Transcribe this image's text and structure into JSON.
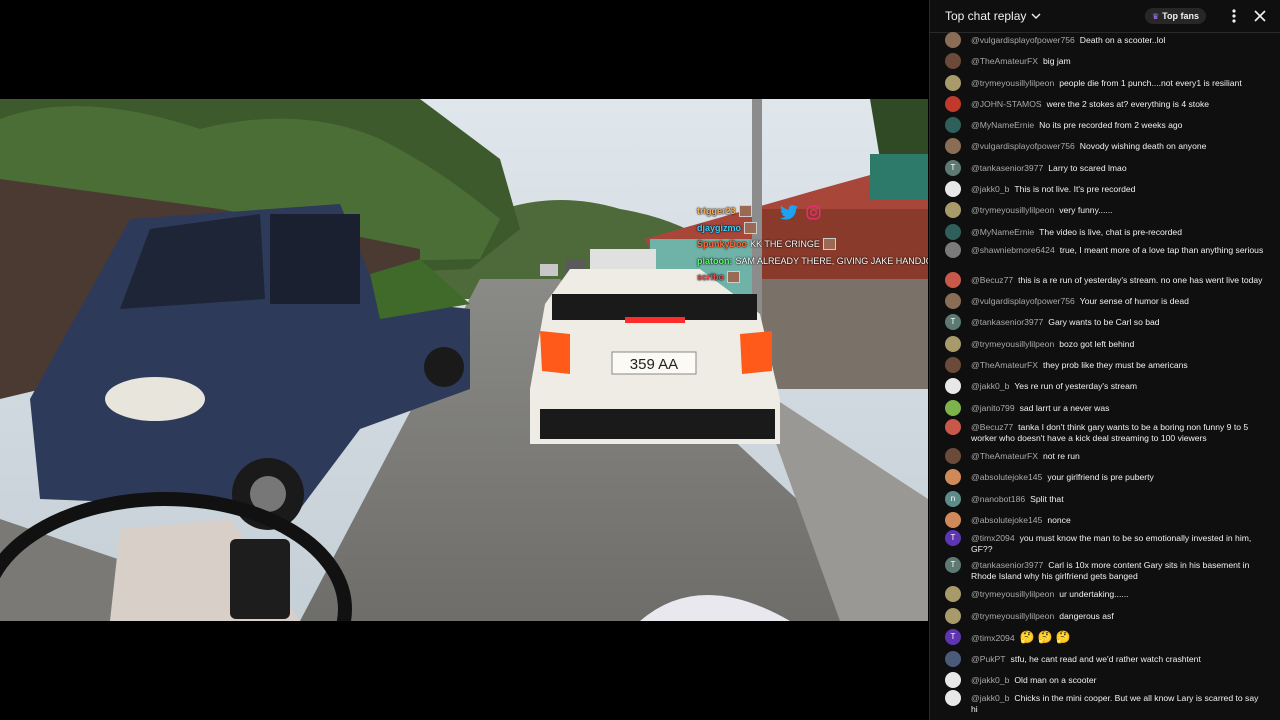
{
  "video": {
    "overlay_chat": [
      {
        "user": "trigger23",
        "text": "",
        "color": "#ffb35a"
      },
      {
        "user": "djaygizmo",
        "text": "",
        "color": "#3ad0ff"
      },
      {
        "user": "SpunkyDoo",
        "text": "KK THE CRINGE",
        "color": "#ff6a3a"
      },
      {
        "user": "platoon:",
        "text": "SAM ALREADY THERE, GIVING JAKE HANDJOB",
        "color": "#5aff6a"
      },
      {
        "user": "scribo",
        "text": "",
        "color": "#ff4a4a"
      }
    ],
    "social_icons": [
      "twitter-icon",
      "instagram-icon"
    ],
    "plate_text": "359 AA"
  },
  "chat": {
    "header": {
      "mode_label": "Top chat replay",
      "top_fans_label": "Top fans"
    },
    "messages": [
      {
        "author": "@vulgardisplayofpower756",
        "text": "Death on a scooter..lol",
        "avatar_color": "#8a6d55",
        "avatar_letter": ""
      },
      {
        "author": "@TheAmateurFX",
        "text": "big jam",
        "avatar_color": "#6b4a3a",
        "avatar_letter": ""
      },
      {
        "author": "@trymeyousillylilpeon",
        "text": "people die from 1 punch....not every1 is resiliant",
        "avatar_color": "#a89a6a",
        "avatar_letter": ""
      },
      {
        "author": "@JOHN-STAMOS",
        "text": "were the 2 stokes at? everything is 4 stoke",
        "avatar_color": "#c0392b",
        "avatar_letter": ""
      },
      {
        "author": "@MyNameErnie",
        "text": "No its pre recorded from 2 weeks ago",
        "avatar_color": "#2f5f5a",
        "avatar_letter": ""
      },
      {
        "author": "@vulgardisplayofpower756",
        "text": "Novody wishing death on anyone",
        "avatar_color": "#8a6d55",
        "avatar_letter": ""
      },
      {
        "author": "@tankasenior3977",
        "text": "Larry to scared lmao",
        "avatar_color": "#5d7a72",
        "avatar_letter": "T"
      },
      {
        "author": "@jakk0_b",
        "text": "This is not live. It's pre recorded",
        "avatar_color": "#e8e8e8",
        "avatar_letter": ""
      },
      {
        "author": "@trymeyousillylilpeon",
        "text": "very funny......",
        "avatar_color": "#a89a6a",
        "avatar_letter": ""
      },
      {
        "author": "@MyNameErnie",
        "text": "The video is live, chat is pre-recorded",
        "avatar_color": "#2f5f5a",
        "avatar_letter": ""
      },
      {
        "author": "@shawniebmore6424",
        "text": "true, I meant more of a love tap than anything serious",
        "avatar_color": "#7a7a7a",
        "avatar_letter": ""
      },
      {
        "author": "@Becuz77",
        "text": "this is a re run of yesterday's stream. no one has went live today",
        "avatar_color": "#c8584a",
        "avatar_letter": ""
      },
      {
        "author": "@vulgardisplayofpower756",
        "text": "Your sense of humor is dead",
        "avatar_color": "#8a6d55",
        "avatar_letter": ""
      },
      {
        "author": "@tankasenior3977",
        "text": "Gary wants to be Carl so bad",
        "avatar_color": "#5d7a72",
        "avatar_letter": "T"
      },
      {
        "author": "@trymeyousillylilpeon",
        "text": "bozo got left behind",
        "avatar_color": "#a89a6a",
        "avatar_letter": ""
      },
      {
        "author": "@TheAmateurFX",
        "text": "they prob like they must be americans",
        "avatar_color": "#6b4a3a",
        "avatar_letter": ""
      },
      {
        "author": "@jakk0_b",
        "text": "Yes re run of yesterday's stream",
        "avatar_color": "#e8e8e8",
        "avatar_letter": ""
      },
      {
        "author": "@janito799",
        "text": "sad larrt ur a never was",
        "avatar_color": "#7cb34a",
        "avatar_letter": ""
      },
      {
        "author": "@Becuz77",
        "text": "tanka I don't think gary wants to be a boring non funny 9 to 5 worker who doesn't have a kick deal streaming to 100 viewers",
        "avatar_color": "#c8584a",
        "avatar_letter": ""
      },
      {
        "author": "@TheAmateurFX",
        "text": "not re run",
        "avatar_color": "#6b4a3a",
        "avatar_letter": ""
      },
      {
        "author": "@absolutejoke145",
        "text": "your girlfriend is pre puberty",
        "avatar_color": "#d08a5a",
        "avatar_letter": ""
      },
      {
        "author": "@nanobot186",
        "text": "Split that",
        "avatar_color": "#5f8a8a",
        "avatar_letter": "n"
      },
      {
        "author": "@absolutejoke145",
        "text": "nonce",
        "avatar_color": "#d08a5a",
        "avatar_letter": ""
      },
      {
        "author": "@timx2094",
        "text": "you must know the man to be so emotionally invested in him, GF??",
        "avatar_color": "#5e35b1",
        "avatar_letter": "T"
      },
      {
        "author": "@tankasenior3977",
        "text": "Carl is 10x more content Gary sits in his basement in Rhode Island why his girlfriend gets banged",
        "avatar_color": "#5d7a72",
        "avatar_letter": "T"
      },
      {
        "author": "@trymeyousillylilpeon",
        "text": "ur undertaking......",
        "avatar_color": "#a89a6a",
        "avatar_letter": ""
      },
      {
        "author": "@trymeyousillylilpeon",
        "text": "dangerous asf",
        "avatar_color": "#a89a6a",
        "avatar_letter": ""
      },
      {
        "author": "@timx2094",
        "text": "🤔🤔🤔",
        "avatar_color": "#5e35b1",
        "avatar_letter": "T"
      },
      {
        "author": "@PukPT",
        "text": "stfu, he cant read and we'd rather watch crashtent",
        "avatar_color": "#4a5a7a",
        "avatar_letter": ""
      },
      {
        "author": "@jakk0_b",
        "text": "Old man on a scooter",
        "avatar_color": "#e8e8e8",
        "avatar_letter": ""
      },
      {
        "author": "@jakk0_b",
        "text": "Chicks in the mini cooper. But we all know Lary is scarred to say hi",
        "avatar_color": "#e8e8e8",
        "avatar_letter": ""
      }
    ]
  }
}
